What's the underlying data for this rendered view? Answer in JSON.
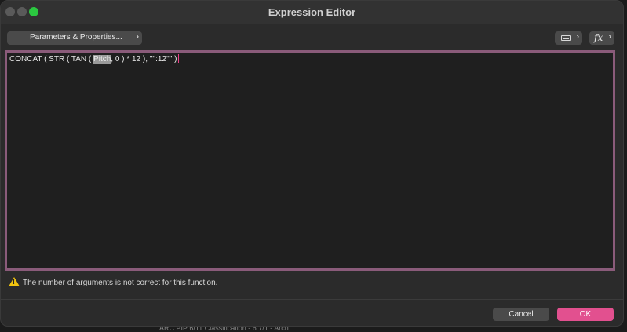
{
  "window": {
    "title": "Expression Editor"
  },
  "toolbar": {
    "params_label": "Parameters & Properties...",
    "params_chevron": "›",
    "keyboard_icon": "keyboard-icon",
    "keyboard_chevron": "›",
    "fx_icon": "fx-icon",
    "fx_label": "fx",
    "fx_chevron": "›"
  },
  "editor": {
    "before": "CONCAT ( STR ( TAN ( ",
    "selected": "Pitch",
    "after": ", 0 ) * 12 ), \"'':12''\" )"
  },
  "warning": {
    "icon": "warning-icon",
    "text": "The number of arguments is not correct for this function."
  },
  "buttons": {
    "cancel": "Cancel",
    "ok": "OK"
  },
  "background": {
    "snippet": "ARC PIP 6/11 Classification - 6 7/1 - Arch"
  },
  "colors": {
    "accent": "#e2508f",
    "editor_border": "#8a5b7a",
    "warning": "#f1c40f"
  }
}
